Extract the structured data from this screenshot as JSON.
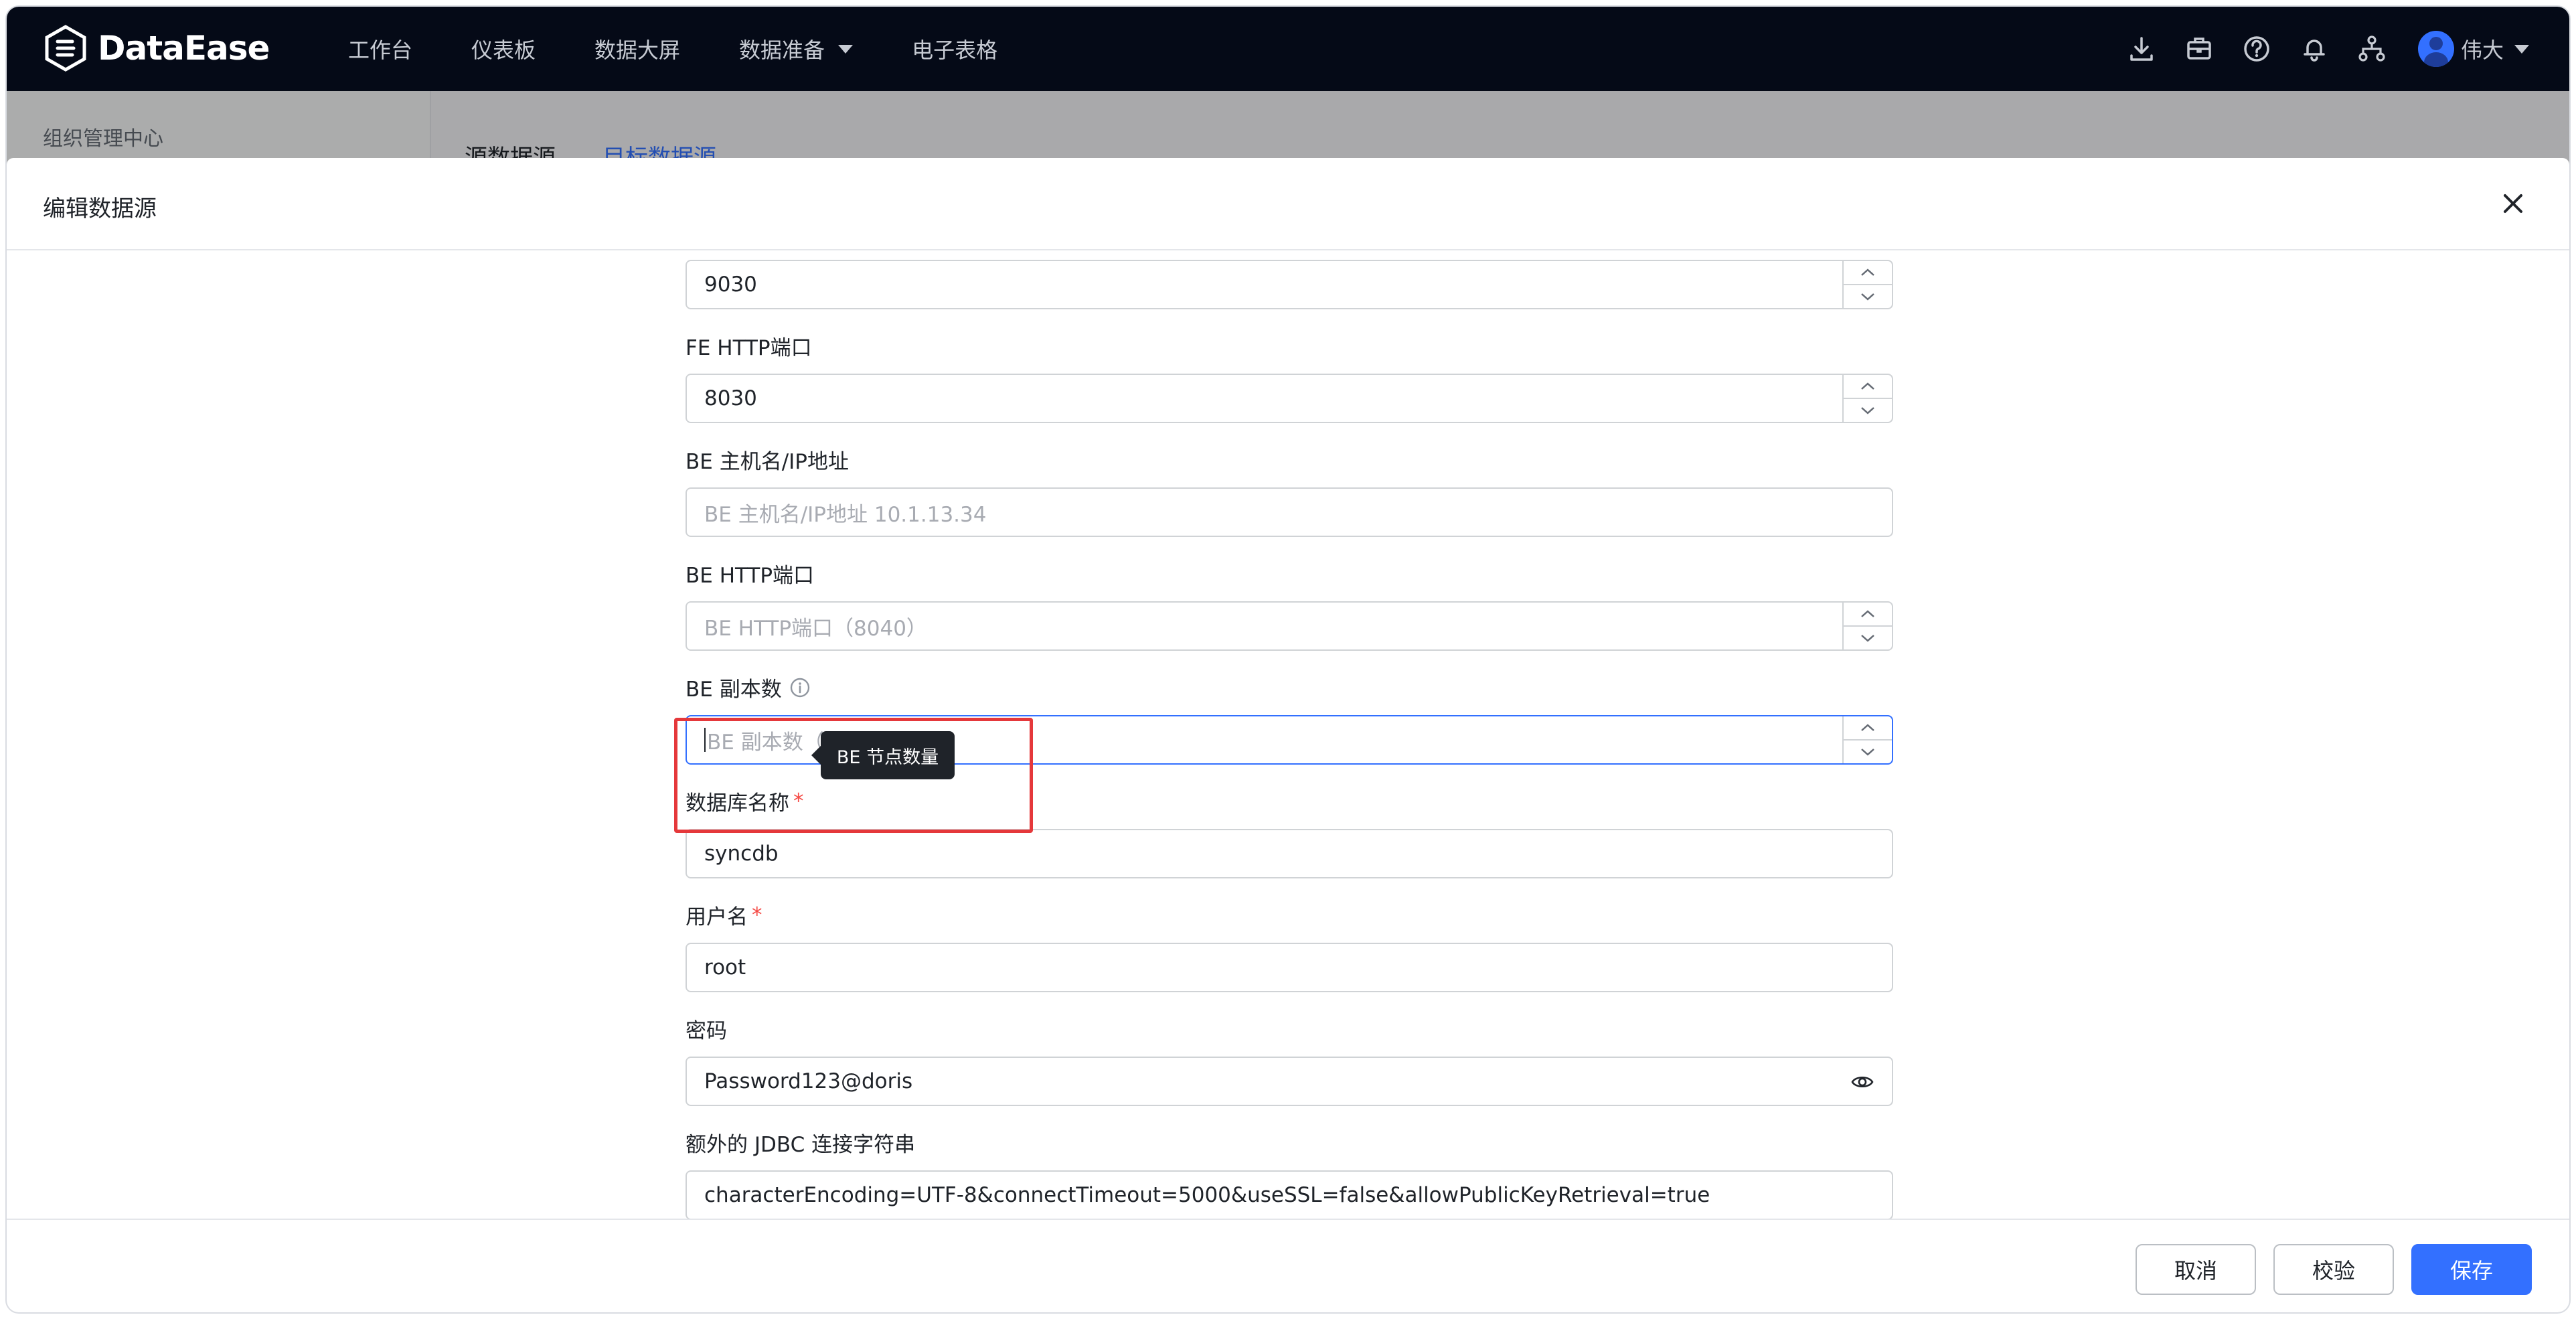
{
  "app": {
    "logo_text": "DataEase",
    "nav": [
      {
        "label": "工作台"
      },
      {
        "label": "仪表板"
      },
      {
        "label": "数据大屏"
      },
      {
        "label": "数据准备",
        "dropdown": true
      },
      {
        "label": "电子表格"
      }
    ],
    "tools": [
      "download-icon",
      "briefcase-icon",
      "help-icon",
      "bell-icon",
      "org-chart-icon"
    ],
    "user": {
      "name": "伟大"
    }
  },
  "background": {
    "sidebar_title": "组织管理中心",
    "tabs": [
      "源数据源",
      "目标数据源"
    ]
  },
  "dialog": {
    "title": "编辑数据源",
    "fields": {
      "fe_query_port": {
        "value": "9030"
      },
      "fe_http_port": {
        "label": "FE HTTP端口",
        "value": "8030"
      },
      "be_host": {
        "label": "BE 主机名/IP地址",
        "placeholder": "BE 主机名/IP地址 10.1.13.34"
      },
      "be_http_port": {
        "label": "BE HTTP端口",
        "placeholder": "BE HTTP端口（8040）"
      },
      "be_replicas": {
        "label": "BE 副本数",
        "placeholder": "BE 副本数（1）",
        "tooltip": "BE 节点数量"
      },
      "database": {
        "label": "数据库名称",
        "required": "*",
        "value": "syncdb"
      },
      "username": {
        "label": "用户名",
        "required": "*",
        "value": "root"
      },
      "password": {
        "label": "密码",
        "value": "Password123@doris"
      },
      "jdbc_extra": {
        "label": "额外的 JDBC 连接字符串",
        "value": "characterEncoding=UTF-8&connectTimeout=5000&useSSL=false&allowPublicKeyRetrieval=true"
      }
    },
    "buttons": {
      "cancel": "取消",
      "verify": "校验",
      "save": "保存"
    }
  },
  "colors": {
    "accent": "#3370ff",
    "topbar": "#050a17",
    "highlight_box": "#e5383b",
    "required": "#f54a45"
  }
}
